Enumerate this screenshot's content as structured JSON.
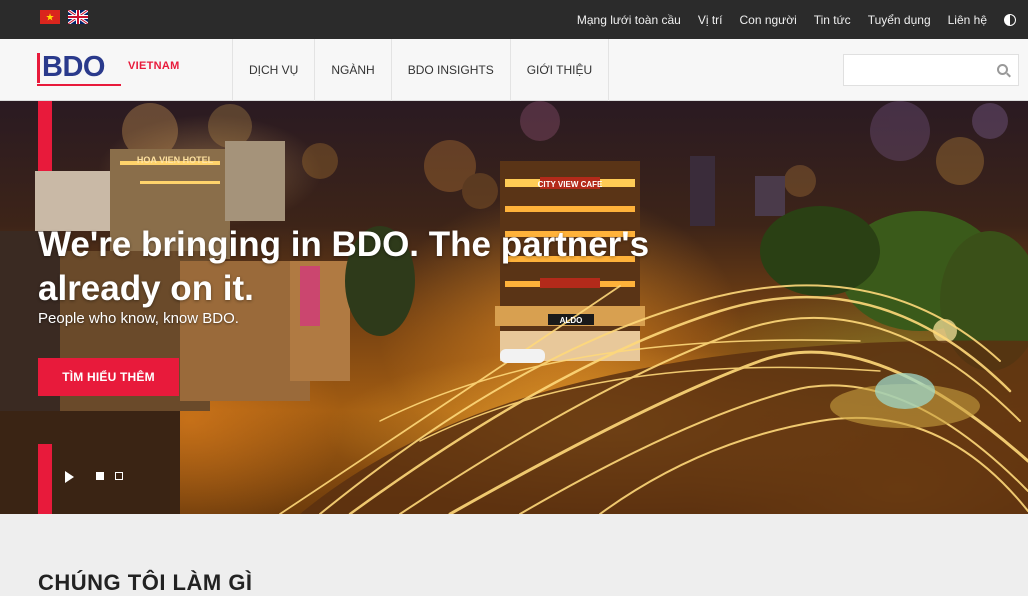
{
  "topbar": {
    "links": [
      "Mạng lưới toàn cầu",
      "Vị trí",
      "Con người",
      "Tin tức",
      "Tuyển dụng",
      "Liên hệ"
    ]
  },
  "logo": {
    "brand": "BDO",
    "country": "VIETNAM"
  },
  "nav": {
    "items": [
      "DỊCH VỤ",
      "NGÀNH",
      "BDO INSIGHTS",
      "GIỚI THIỆU"
    ]
  },
  "search": {
    "placeholder": ""
  },
  "hero": {
    "title": "We're bringing in BDO. The partner's already on it.",
    "subtitle": "People who know, know BDO.",
    "button": "TÌM HIỂU THÊM",
    "signs": {
      "hotel": "HOA VIEN HOTEL",
      "cafe": "CITY VIEW CAFE",
      "shop": "ALDO"
    }
  },
  "section": {
    "title": "CHÚNG TÔI LÀM GÌ",
    "link": ""
  },
  "colors": {
    "brand_red": "#e81a3b",
    "brand_blue": "#2a3a8c",
    "topbar_bg": "#2b2b2b"
  }
}
